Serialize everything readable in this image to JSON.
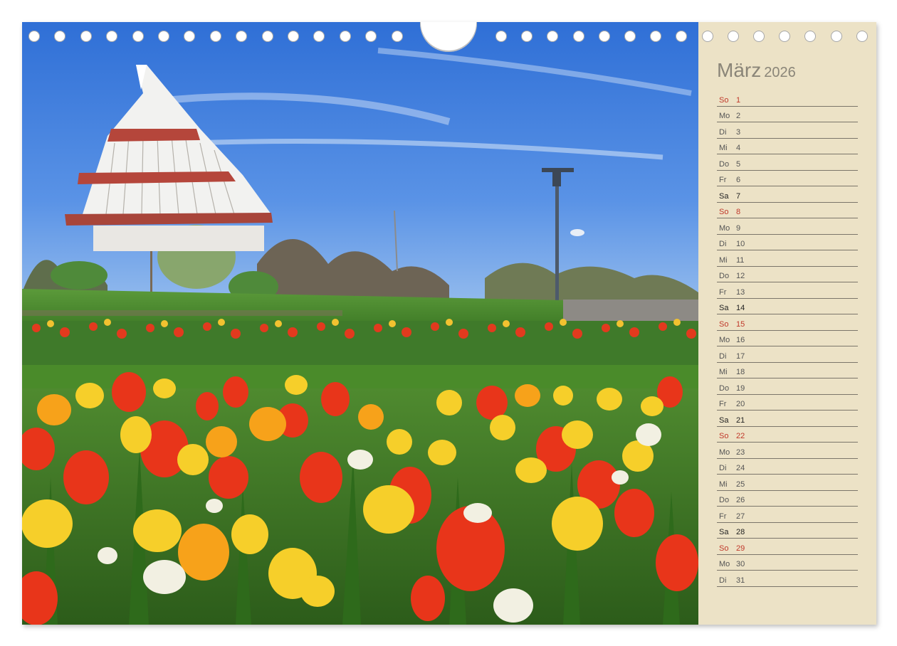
{
  "calendar": {
    "month": "März",
    "year": "2026",
    "days": [
      {
        "dn": "So",
        "dd": "1",
        "kind": "sun"
      },
      {
        "dn": "Mo",
        "dd": "2",
        "kind": "wd"
      },
      {
        "dn": "Di",
        "dd": "3",
        "kind": "wd"
      },
      {
        "dn": "Mi",
        "dd": "4",
        "kind": "wd"
      },
      {
        "dn": "Do",
        "dd": "5",
        "kind": "wd"
      },
      {
        "dn": "Fr",
        "dd": "6",
        "kind": "wd"
      },
      {
        "dn": "Sa",
        "dd": "7",
        "kind": "sat"
      },
      {
        "dn": "So",
        "dd": "8",
        "kind": "sun"
      },
      {
        "dn": "Mo",
        "dd": "9",
        "kind": "wd"
      },
      {
        "dn": "Di",
        "dd": "10",
        "kind": "wd"
      },
      {
        "dn": "Mi",
        "dd": "11",
        "kind": "wd"
      },
      {
        "dn": "Do",
        "dd": "12",
        "kind": "wd"
      },
      {
        "dn": "Fr",
        "dd": "13",
        "kind": "wd"
      },
      {
        "dn": "Sa",
        "dd": "14",
        "kind": "sat"
      },
      {
        "dn": "So",
        "dd": "15",
        "kind": "sun"
      },
      {
        "dn": "Mo",
        "dd": "16",
        "kind": "wd"
      },
      {
        "dn": "Di",
        "dd": "17",
        "kind": "wd"
      },
      {
        "dn": "Mi",
        "dd": "18",
        "kind": "wd"
      },
      {
        "dn": "Do",
        "dd": "19",
        "kind": "wd"
      },
      {
        "dn": "Fr",
        "dd": "20",
        "kind": "wd"
      },
      {
        "dn": "Sa",
        "dd": "21",
        "kind": "sat"
      },
      {
        "dn": "So",
        "dd": "22",
        "kind": "sun"
      },
      {
        "dn": "Mo",
        "dd": "23",
        "kind": "wd"
      },
      {
        "dn": "Di",
        "dd": "24",
        "kind": "wd"
      },
      {
        "dn": "Mi",
        "dd": "25",
        "kind": "wd"
      },
      {
        "dn": "Do",
        "dd": "26",
        "kind": "wd"
      },
      {
        "dn": "Fr",
        "dd": "27",
        "kind": "wd"
      },
      {
        "dn": "Sa",
        "dd": "28",
        "kind": "sat"
      },
      {
        "dn": "So",
        "dd": "29",
        "kind": "sun"
      },
      {
        "dn": "Mo",
        "dd": "30",
        "kind": "wd"
      },
      {
        "dn": "Di",
        "dd": "31",
        "kind": "wd"
      }
    ]
  },
  "photo": {
    "subject": "tulip-field-with-conical-tower"
  },
  "colors": {
    "sidebar_bg": "#ece2c6",
    "sunday": "#c0392b",
    "saturday": "#222222",
    "weekday": "#555555",
    "sky": "#3b78d8"
  }
}
